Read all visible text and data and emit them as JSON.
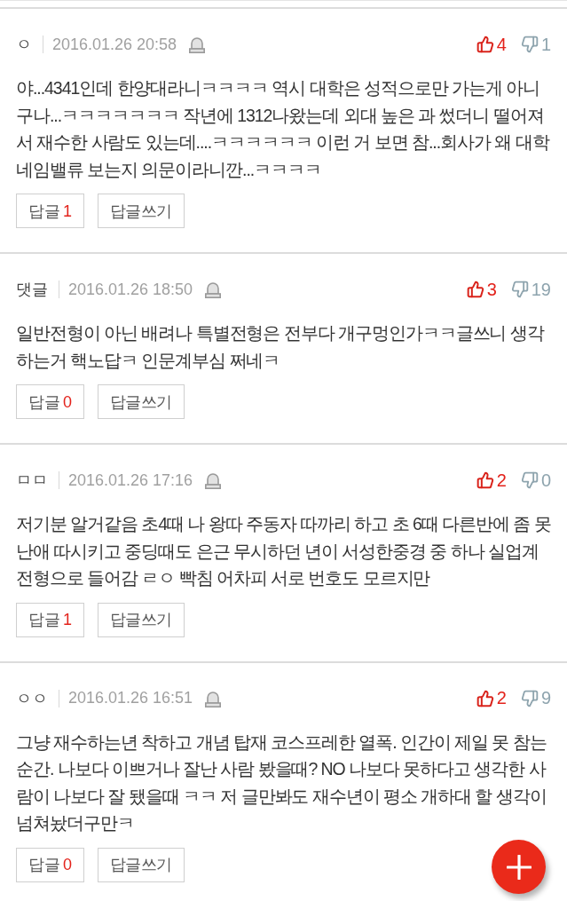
{
  "comments": [
    {
      "author": "ㅇ",
      "date": "2016.01.26 20:58",
      "likes": "4",
      "dislikes": "1",
      "body": "야...4341인데 한양대라니ㅋㅋㅋㅋ 역시 대학은 성적으로만 가는게 아니구나...ㅋㅋㅋㅋㅋㅋㅋ 작년에 1312나왔는데 외대 높은 과 썼더니 떨어져서 재수한 사람도 있는데....ㅋㅋㅋㅋㅋㅋ 이런 거 보면 참...회사가 왜 대학 네임밸류 보는지 의문이라니깐...ㅋㅋㅋㅋ",
      "reply_label": "답글",
      "reply_count": "1",
      "write_reply": "답글쓰기"
    },
    {
      "author": "댓글",
      "date": "2016.01.26 18:50",
      "likes": "3",
      "dislikes": "19",
      "body": "일반전형이 아닌 배려나 특별전형은 전부다 개구멍인가ㅋㅋ글쓰니 생각하는거 핵노답ㅋ 인문계부심 쩌네ㅋ",
      "reply_label": "답글",
      "reply_count": "0",
      "write_reply": "답글쓰기"
    },
    {
      "author": "ㅁㅁ",
      "date": "2016.01.26 17:16",
      "likes": "2",
      "dislikes": "0",
      "body": "저기분 알거같음 초4때 나 왕따 주동자 따까리 하고 초 6때 다른반에 좀 못난애 따시키고 중딩때도 은근 무시하던 년이 서성한중경 중 하나 실업계 전형으로 들어감 ㄹㅇ 빡침 어차피 서로 번호도 모르지만",
      "reply_label": "답글",
      "reply_count": "1",
      "write_reply": "답글쓰기"
    },
    {
      "author": "ㅇㅇ",
      "date": "2016.01.26 16:51",
      "likes": "2",
      "dislikes": "9",
      "body": "그냥 재수하는년 착하고 개념 탑재 코스프레한 열폭. 인간이 제일 못 참는 순간. 나보다 이쁘거나 잘난 사람 봤을때? NO 나보다 못하다고 생각한 사람이 나보다 잘 됐을때 ㅋㅋ 저 글만봐도 재수년이 평소 개하대 할 생각이 넘쳐놨더구만ㅋ",
      "reply_label": "답글",
      "reply_count": "0",
      "write_reply": "답글쓰기"
    }
  ]
}
